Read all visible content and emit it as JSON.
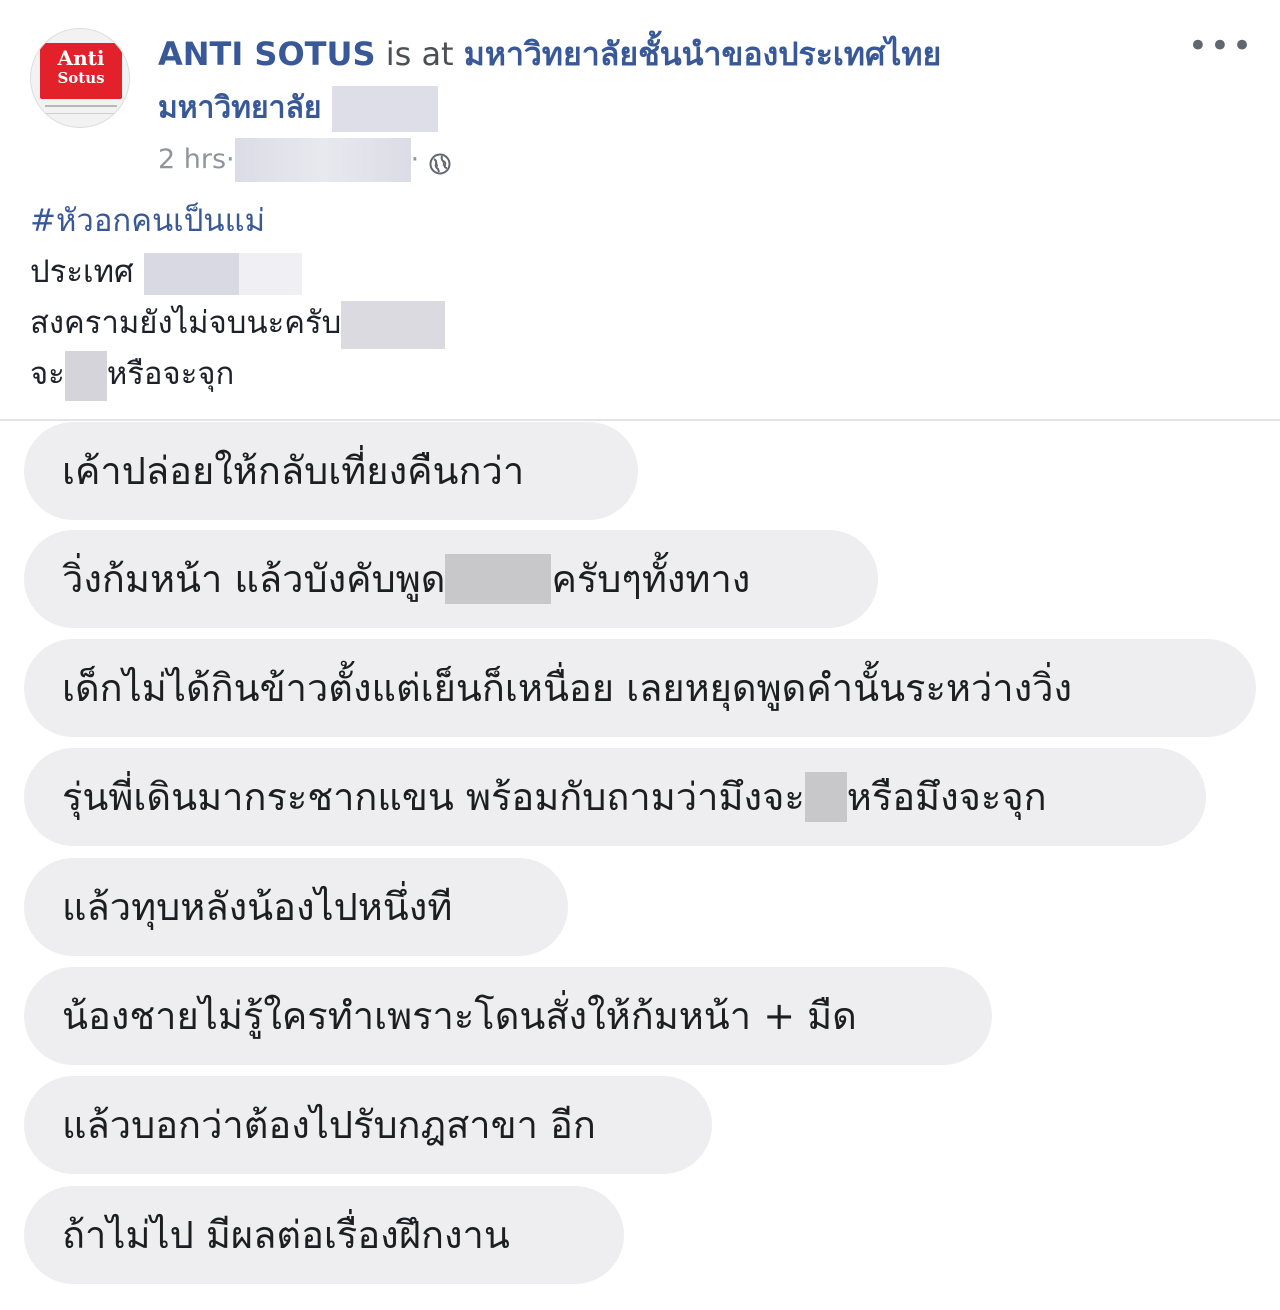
{
  "post": {
    "page_name": "ANTI SOTUS",
    "is_at_text": " is at ",
    "place_name": "มหาวิทยาลัยชั้นนำของประเทศไทย",
    "subplace": "มหาวิทยาลัย",
    "timestamp": "2 hrs",
    "meta_separator": " · ",
    "audience_icon": "globe-icon",
    "more_icon": "more-options-icon",
    "more_label": "•••",
    "avatar_logo_line1": "Anti",
    "avatar_logo_line2": "Sotus",
    "text": {
      "hashtag": "#หัวอกคนเป็นแม่",
      "line2": "ประเทศ",
      "line3": "สงครามยังไม่จบนะครับ",
      "line4_a": "จะ",
      "line4_b": "หรือจะจุก"
    }
  },
  "chat": {
    "messages": [
      {
        "a": "เค้าปล่อยให้กลับเที่ยงคืนกว่า"
      },
      {
        "a": "วิ่งก้มหน้า แล้วบังคับพูด",
        "b": "ครับๆทั้งทาง"
      },
      {
        "a": "เด็กไม่ได้กินข้าวตั้งแต่เย็นก็เหนื่อย เลยหยุดพูดคำนั้นระหว่างวิ่ง"
      },
      {
        "a": "รุ่นพี่เดินมากระชากแขน พร้อมกับถามว่ามึงจะ",
        "b": "หรือมึงจะจุก"
      },
      {
        "a": "แล้วทุบหลังน้องไปหนึ่งที"
      },
      {
        "a": "น้องชายไม่รู้ใครทำเพราะโดนสั่งให้ก้มหน้า + มืด"
      },
      {
        "a": "แล้วบอกว่าต้องไปรับกฎสาขา อีก"
      },
      {
        "a": "ถ้าไม่ไป มีผลต่อเรื่องฝึกงาน"
      }
    ]
  },
  "colors": {
    "link": "#385898",
    "bubble_bg": "#eeeef0",
    "logo_red": "#e3212b",
    "meta_gray": "#90949c"
  }
}
